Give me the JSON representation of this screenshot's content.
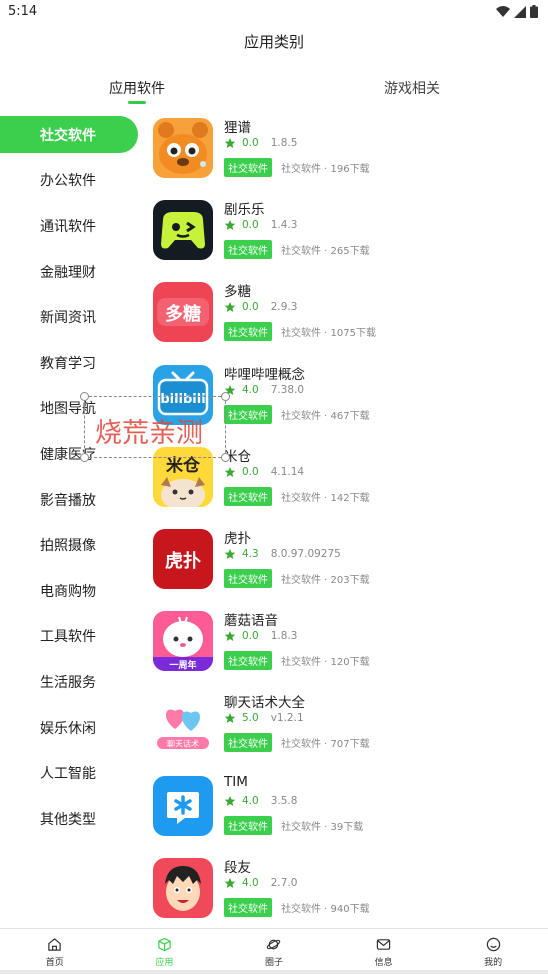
{
  "status_bar": {
    "time": "5:14"
  },
  "title": "应用类别",
  "tabs": [
    {
      "label": "应用软件",
      "active": true
    },
    {
      "label": "游戏相关",
      "active": false
    }
  ],
  "sidebar": {
    "items": [
      {
        "label": "社交软件",
        "active": true
      },
      {
        "label": "办公软件"
      },
      {
        "label": "通讯软件"
      },
      {
        "label": "金融理财"
      },
      {
        "label": "新闻资讯"
      },
      {
        "label": "教育学习"
      },
      {
        "label": "地图导航"
      },
      {
        "label": "健康医疗"
      },
      {
        "label": "影音播放"
      },
      {
        "label": "拍照摄像"
      },
      {
        "label": "电商购物"
      },
      {
        "label": "工具软件"
      },
      {
        "label": "生活服务"
      },
      {
        "label": "娱乐休闲"
      },
      {
        "label": "人工智能"
      },
      {
        "label": "其他类型"
      }
    ]
  },
  "apps": [
    {
      "name": "狸谱",
      "rating": "0.0",
      "version": "1.8.5",
      "badge": "社交软件",
      "sub": "社交软件 · 196下载",
      "icon": "raccoon-app-icon"
    },
    {
      "name": "剧乐乐",
      "rating": "0.0",
      "version": "1.4.3",
      "badge": "社交软件",
      "sub": "社交软件 · 265下载",
      "icon": "game-controller-app-icon"
    },
    {
      "name": "多糖",
      "rating": "0.0",
      "version": "2.9.3",
      "badge": "社交软件",
      "sub": "社交软件 · 1075下载",
      "icon": "duotang-app-icon"
    },
    {
      "name": "哔哩哔哩概念",
      "rating": "4.0",
      "version": "7.38.0",
      "badge": "社交软件",
      "sub": "社交软件 · 467下载",
      "icon": "bilibili-app-icon"
    },
    {
      "name": "米仓",
      "rating": "0.0",
      "version": "4.1.14",
      "badge": "社交软件",
      "sub": "社交软件 · 142下载",
      "icon": "micang-app-icon"
    },
    {
      "name": "虎扑",
      "rating": "4.3",
      "version": "8.0.97.09275",
      "badge": "社交软件",
      "sub": "社交软件 · 203下载",
      "icon": "hupu-app-icon"
    },
    {
      "name": "蘑菇语音",
      "rating": "0.0",
      "version": "1.8.3",
      "badge": "社交软件",
      "sub": "社交软件 · 120下载",
      "icon": "mogu-app-icon"
    },
    {
      "name": "聊天话术大全",
      "rating": "5.0",
      "version": "v1.2.1",
      "badge": "社交软件",
      "sub": "社交软件 · 707下载",
      "icon": "hearts-app-icon"
    },
    {
      "name": "TIM",
      "rating": "4.0",
      "version": "3.5.8",
      "badge": "社交软件",
      "sub": "社交软件 · 39下载",
      "icon": "tim-app-icon"
    },
    {
      "name": "段友",
      "rating": "4.0",
      "version": "2.7.0",
      "badge": "社交软件",
      "sub": "社交软件 · 940下载",
      "icon": "duanyou-app-icon"
    }
  ],
  "icon_texts": {
    "duotang": "多糖",
    "bilibili": "bilibili",
    "micang": "米仓",
    "hupu": "虎扑",
    "mogu_banner": "一周年",
    "hearts_banner": "聊天话术"
  },
  "watermark": {
    "text": "烧荒亲测"
  },
  "bottom_nav": [
    {
      "label": "首页",
      "icon": "home-icon"
    },
    {
      "label": "应用",
      "icon": "cube-icon",
      "active": true
    },
    {
      "label": "圈子",
      "icon": "planet-icon"
    },
    {
      "label": "信息",
      "icon": "mail-icon"
    },
    {
      "label": "我的",
      "icon": "smile-icon"
    }
  ],
  "colors": {
    "accent": "#3ccf4e",
    "rating": "#3aaa35"
  }
}
